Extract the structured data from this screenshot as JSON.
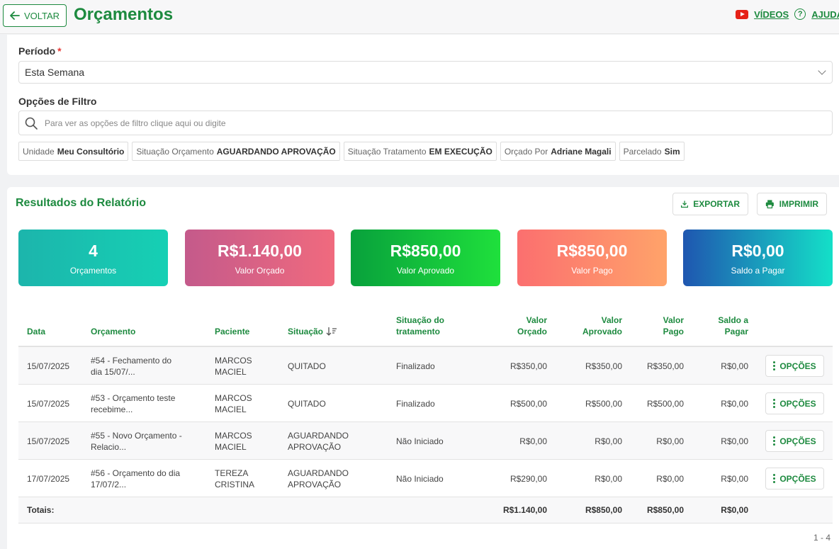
{
  "header": {
    "back_label": "VOLTAR",
    "title": "Orçamentos",
    "videos_label": "VÍDEOS",
    "help_label": "AJUDA"
  },
  "filters": {
    "period_label": "Período",
    "period_value": "Esta Semana",
    "options_label": "Opções de Filtro",
    "search_placeholder": "Para ver as opções de filtro clique aqui ou digite",
    "chips": [
      {
        "key": "Unidade",
        "value": "Meu Consultório"
      },
      {
        "key": "Situação Orçamento",
        "value": "AGUARDANDO APROVAÇÃO"
      },
      {
        "key": "Situação Tratamento",
        "value": "EM EXECUÇÃO"
      },
      {
        "key": "Orçado Por",
        "value": "Adriane Magali"
      },
      {
        "key": "Parcelado",
        "value": "Sim"
      }
    ]
  },
  "results": {
    "title": "Resultados do Relatório",
    "export_label": "EXPORTAR",
    "print_label": "IMPRIMIR",
    "cards": [
      {
        "value": "4",
        "label": "Orçamentos"
      },
      {
        "value": "R$1.140,00",
        "label": "Valor Orçado"
      },
      {
        "value": "R$850,00",
        "label": "Valor Aprovado"
      },
      {
        "value": "R$850,00",
        "label": "Valor Pago"
      },
      {
        "value": "R$0,00",
        "label": "Saldo a Pagar"
      }
    ]
  },
  "table": {
    "headers": {
      "data": "Data",
      "orcamento": "Orçamento",
      "paciente": "Paciente",
      "situacao": "Situação",
      "trat1": "Situação do",
      "trat2": "tratamento",
      "vo1": "Valor",
      "vo2": "Orçado",
      "va1": "Valor",
      "va2": "Aprovado",
      "vp1": "Valor",
      "vp2": "Pago",
      "sp1": "Saldo a",
      "sp2": "Pagar"
    },
    "rows": [
      {
        "date": "15/07/2025",
        "orc1": "#54 - Fechamento do",
        "orc2": "dia 15/07/...",
        "pac1": "MARCOS",
        "pac2": "MACIEL",
        "sit1": "QUITADO",
        "sit2": "",
        "trat": "Finalizado",
        "vo": "R$350,00",
        "va": "R$350,00",
        "vp": "R$350,00",
        "sp": "R$0,00",
        "opt": "OPÇÕES"
      },
      {
        "date": "15/07/2025",
        "orc1": "#53 - Orçamento teste",
        "orc2": "recebime...",
        "pac1": "MARCOS",
        "pac2": "MACIEL",
        "sit1": "QUITADO",
        "sit2": "",
        "trat": "Finalizado",
        "vo": "R$500,00",
        "va": "R$500,00",
        "vp": "R$500,00",
        "sp": "R$0,00",
        "opt": "OPÇÕES"
      },
      {
        "date": "15/07/2025",
        "orc1": "#55 - Novo Orçamento -",
        "orc2": "Relacio...",
        "pac1": "MARCOS",
        "pac2": "MACIEL",
        "sit1": "AGUARDANDO",
        "sit2": "APROVAÇÃO",
        "trat": "Não Iniciado",
        "vo": "R$0,00",
        "va": "R$0,00",
        "vp": "R$0,00",
        "sp": "R$0,00",
        "opt": "OPÇÕES"
      },
      {
        "date": "17/07/2025",
        "orc1": "#56 - Orçamento do dia",
        "orc2": "17/07/2...",
        "pac1": "TEREZA",
        "pac2": "CRISTINA",
        "sit1": "AGUARDANDO",
        "sit2": "APROVAÇÃO",
        "trat": "Não Iniciado",
        "vo": "R$290,00",
        "va": "R$0,00",
        "vp": "R$0,00",
        "sp": "R$0,00",
        "opt": "OPÇÕES"
      }
    ],
    "totals": {
      "label": "Totais:",
      "vo": "R$1.140,00",
      "va": "R$850,00",
      "vp": "R$850,00",
      "sp": "R$0,00"
    },
    "pagination": "1 - 4"
  },
  "colors": {
    "brand": "#1d8a3f",
    "card_gradients": [
      [
        "#1cb5ac",
        "#16d0b4"
      ],
      [
        "#c45a8b",
        "#f06a7e"
      ],
      [
        "#08a13c",
        "#1fe03c"
      ],
      [
        "#fb6f6f",
        "#ffa36a"
      ],
      [
        "#1f56b0",
        "#14e0c8"
      ]
    ]
  }
}
